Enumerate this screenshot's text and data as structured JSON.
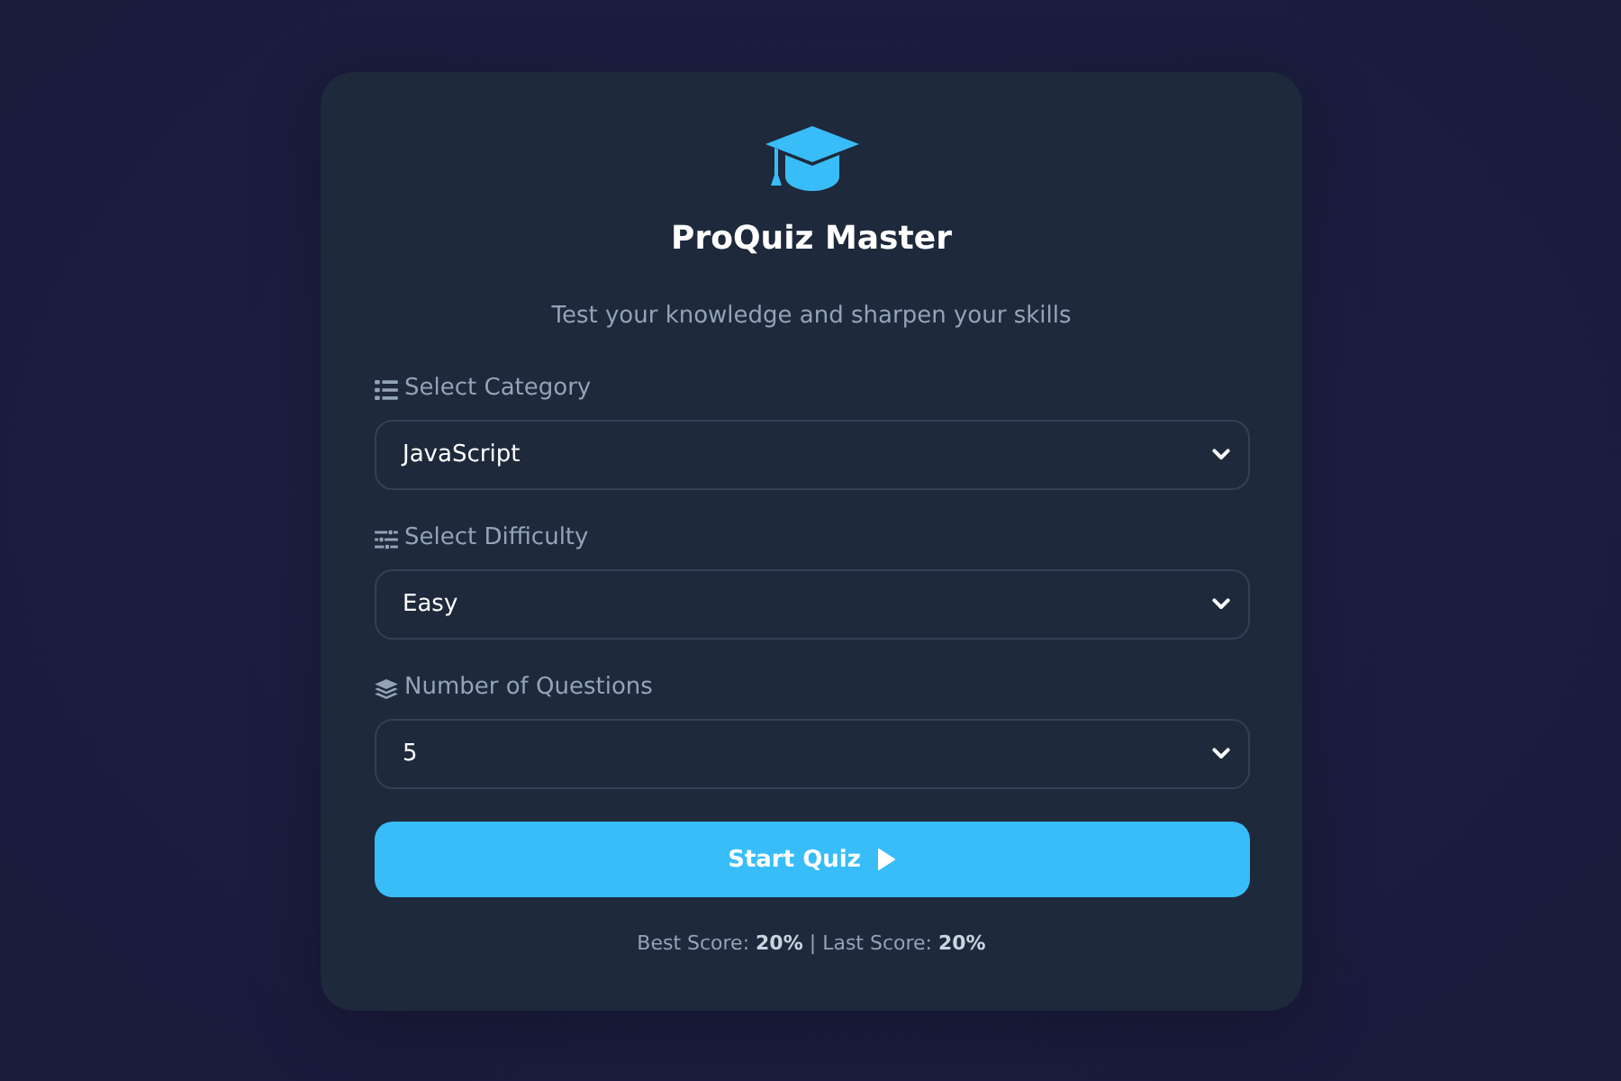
{
  "header": {
    "title": "ProQuiz Master",
    "subtitle": "Test your knowledge and sharpen your skills"
  },
  "fields": [
    {
      "kind": "category",
      "label": "Select Category",
      "value": "JavaScript"
    },
    {
      "kind": "difficulty",
      "label": "Select Difficulty",
      "value": "Easy"
    },
    {
      "kind": "count",
      "label": "Number of Questions",
      "value": "5"
    }
  ],
  "start_button": {
    "label": "Start Quiz"
  },
  "scores": {
    "text": "Best Score: **20%** | Last Score: **20%**"
  }
}
